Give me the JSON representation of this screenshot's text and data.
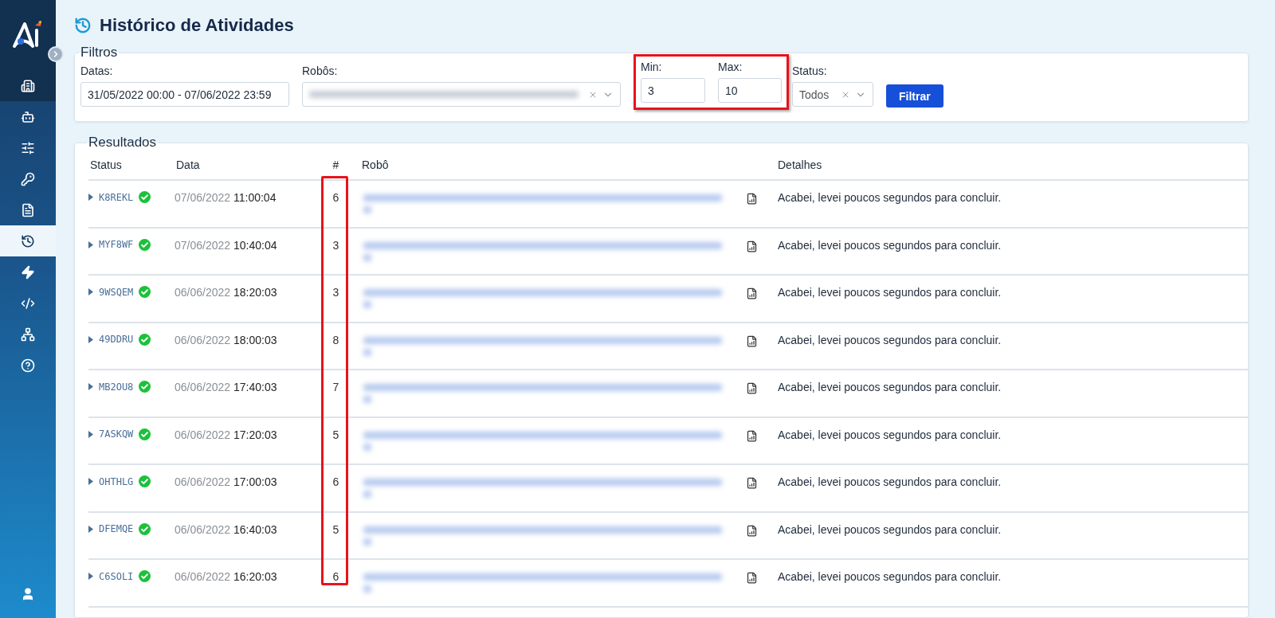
{
  "sidebar": {
    "items": [
      {
        "kind": "building",
        "selected": false
      },
      {
        "kind": "robot",
        "selected": false
      },
      {
        "kind": "sliders",
        "selected": false
      },
      {
        "kind": "key",
        "selected": false
      },
      {
        "kind": "invoice",
        "selected": false
      },
      {
        "kind": "history",
        "selected": true
      },
      {
        "kind": "bolt",
        "selected": false
      },
      {
        "kind": "code",
        "selected": false
      },
      {
        "kind": "network",
        "selected": false
      },
      {
        "kind": "help",
        "selected": false
      }
    ]
  },
  "page": {
    "title": "Histórico de Atividades"
  },
  "filters": {
    "legend": "Filtros",
    "dates": {
      "label": "Datas:",
      "value": "31/05/2022 00:00 - 07/06/2022 23:59"
    },
    "robots": {
      "label": "Robôs:"
    },
    "range_highlighted": true,
    "min": {
      "label": "Min:",
      "value": "3"
    },
    "max": {
      "label": "Max:",
      "value": "10"
    },
    "status": {
      "label": "Status:",
      "value": "Todos"
    },
    "button": "Filtrar"
  },
  "results": {
    "legend": "Resultados",
    "count_highlighted": true,
    "columns": [
      "Status",
      "Data",
      "#",
      "Robô",
      "Detalhes"
    ],
    "rows": [
      {
        "code": "K8REKL",
        "succeeded": true,
        "date": "07/06/2022",
        "time": "11:00:04",
        "count": "6",
        "details": "Acabei, levei poucos segundos para concluir."
      },
      {
        "code": "MYF8WF",
        "succeeded": true,
        "date": "07/06/2022",
        "time": "10:40:04",
        "count": "3",
        "details": "Acabei, levei poucos segundos para concluir."
      },
      {
        "code": "9WSQEM",
        "succeeded": true,
        "date": "06/06/2022",
        "time": "18:20:03",
        "count": "3",
        "details": "Acabei, levei poucos segundos para concluir."
      },
      {
        "code": "49DDRU",
        "succeeded": true,
        "date": "06/06/2022",
        "time": "18:00:03",
        "count": "8",
        "details": "Acabei, levei poucos segundos para concluir."
      },
      {
        "code": "MB2OU8",
        "succeeded": true,
        "date": "06/06/2022",
        "time": "17:40:03",
        "count": "7",
        "details": "Acabei, levei poucos segundos para concluir."
      },
      {
        "code": "7ASKQW",
        "succeeded": true,
        "date": "06/06/2022",
        "time": "17:20:03",
        "count": "5",
        "details": "Acabei, levei poucos segundos para concluir."
      },
      {
        "code": "OHTHLG",
        "succeeded": true,
        "date": "06/06/2022",
        "time": "17:00:03",
        "count": "6",
        "details": "Acabei, levei poucos segundos para concluir."
      },
      {
        "code": "DFEMQE",
        "succeeded": true,
        "date": "06/06/2022",
        "time": "16:40:03",
        "count": "5",
        "details": "Acabei, levei poucos segundos para concluir."
      },
      {
        "code": "C6SOLI",
        "succeeded": true,
        "date": "06/06/2022",
        "time": "16:20:03",
        "count": "6",
        "details": "Acabei, levei poucos segundos para concluir."
      }
    ]
  }
}
